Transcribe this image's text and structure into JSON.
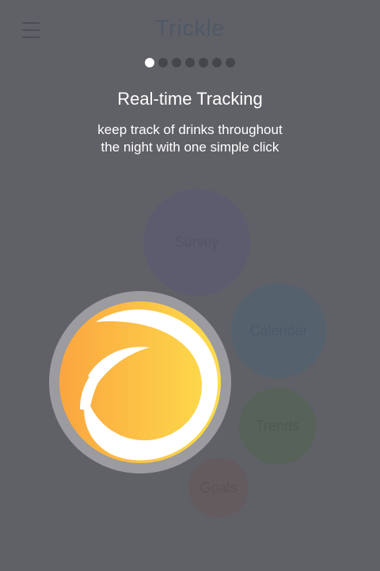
{
  "app": {
    "title": "Trickle"
  },
  "menu": {
    "icon": "menu-icon"
  },
  "bubbles": {
    "survey": "Survey",
    "calendar": "Calendar",
    "trends": "Trends",
    "goals": "Goals"
  },
  "tutorial": {
    "page_count": 7,
    "active_page": 1,
    "title": "Real-time Tracking",
    "description_line1": "keep track of drinks throughout",
    "description_line2": "the night with one simple click",
    "logo_icon": "trickle-logo-icon"
  },
  "colors": {
    "overlay": "#606167",
    "logo_orange": "#fba53f",
    "logo_yellow": "#fdd94a",
    "dot_active": "#ffffff",
    "dot_inactive": "#45464b"
  }
}
